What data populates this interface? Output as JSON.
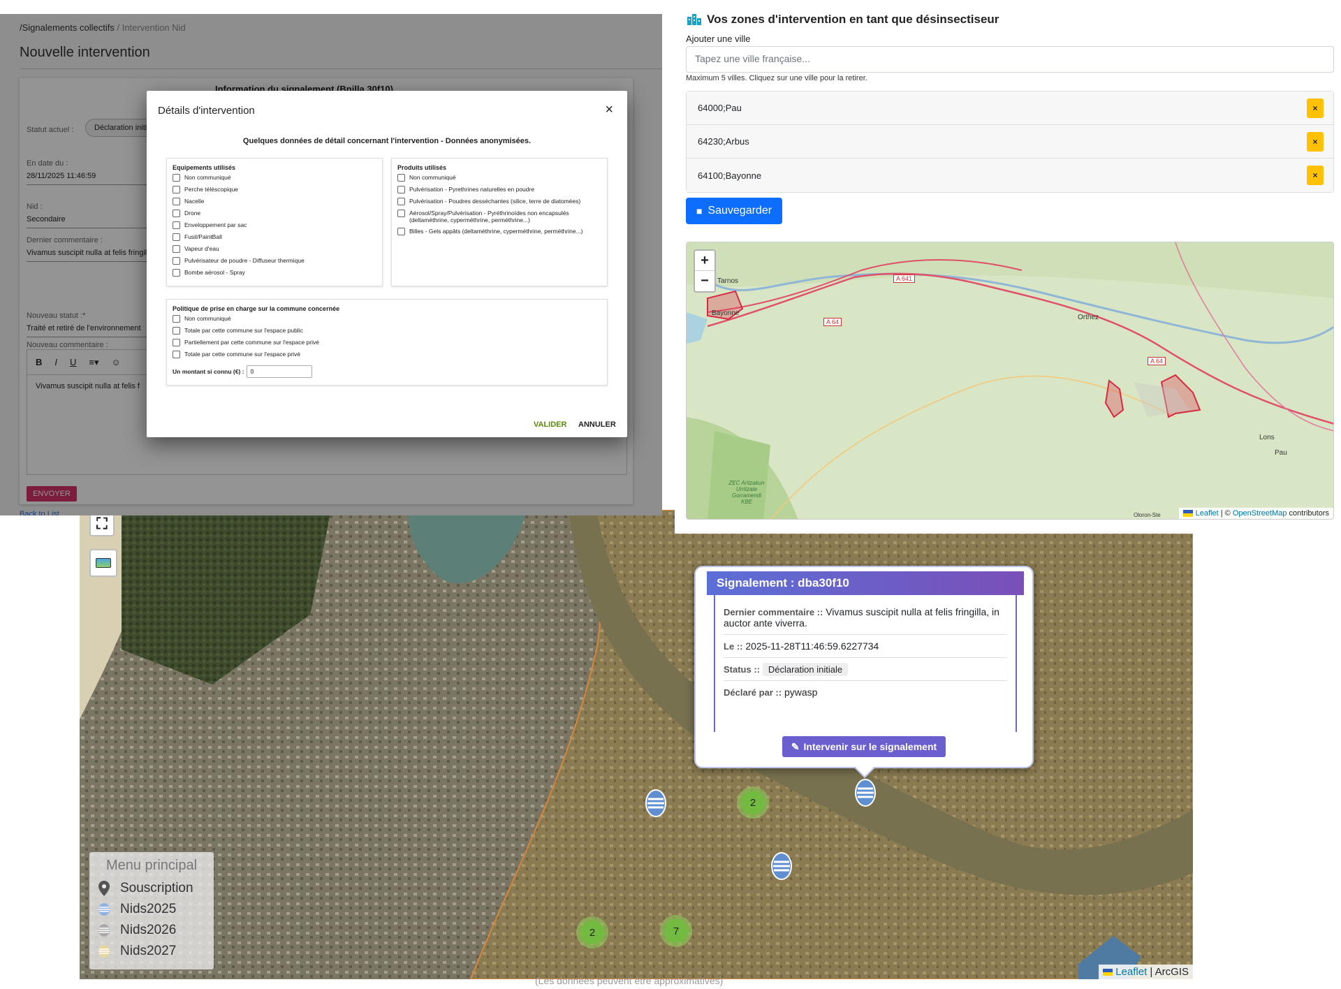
{
  "colors": {
    "primary": "#0d6efd",
    "warning": "#ffc107",
    "send": "#d6336c",
    "popup_header": "#6b5fd0",
    "validate": "#5a8a0a"
  },
  "left_app": {
    "breadcrumb_root": "/Signalements collectifs",
    "breadcrumb_sep": "/",
    "breadcrumb_current": "Intervention Nid",
    "page_title": "Nouvelle intervention",
    "card_heading_partial": "Information du signalement (Bnilla 30f10)",
    "status_label": "Statut actuel :",
    "status_value": "Déclaration initial",
    "date_label": "En date du :",
    "date_value": "28/11/2025 11:46:59",
    "nid_label": "Nid :",
    "nid_value": "Secondaire",
    "last_comment_label": "Dernier commentaire :",
    "last_comment_value": "Vivamus suscipit nulla at felis fringill",
    "new_status_label": "Nouveau statut :*",
    "new_status_value": "Traité et retiré de l'environnement",
    "new_comment_label": "Nouveau commentaire :",
    "editor_text": "Vivamus suscipit nulla at felis f",
    "editor_tools": [
      "B",
      "I",
      "U",
      "≡▾",
      "☺"
    ],
    "send_label": "ENVOYER",
    "back_link": "Back to List"
  },
  "modal": {
    "title": "Détails d'intervention",
    "close": "×",
    "subtitle": "Quelques données de détail concernant l'intervention - Données anonymisées.",
    "equipements": {
      "title": "Equipements utilisés",
      "options": [
        "Non communiqué",
        "Perche téléscopique",
        "Nacelle",
        "Drone",
        "Enveloppement par sac",
        "Fusil/PaintBall",
        "Vapeur d'eau",
        "Pulvérisateur de poudre - Diffuseur thermique",
        "Bombe aérosol - Spray"
      ]
    },
    "produits": {
      "title": "Produits utilisés",
      "options": [
        "Non communiqué",
        "Pulvérisation - Pyrethrines naturelles en poudre",
        "Pulvérisation - Poudres desséchantes (silice, terre de diatomées)",
        "Aérosol/Spray/Pulvérisation - Pyréthrinoïdes non encapsulés (deltaméthrine, cyperméthrine, perméthrine...)",
        "Billes - Gels appâts (deltaméthrine, cyperméthrine, perméthrine...)"
      ]
    },
    "politique": {
      "title": "Politique de prise en charge sur la commune concernée",
      "options": [
        "Non communiqué",
        "Totale par cette commune sur l'espace public",
        "Partiellement par cette commune sur l'espace privé",
        "Totale par cette commune sur l'espace privé"
      ],
      "amount_label": "Un montant si connu (€) :",
      "amount_value": "0"
    },
    "validate": "VALIDER",
    "cancel": "ANNULER"
  },
  "zones": {
    "title": "Vos zones d'intervention en tant que désinsectiseur",
    "add_label": "Ajouter une ville",
    "input_placeholder": "Tapez une ville française...",
    "help": "Maximum 5 villes. Cliquez sur une ville pour la retirer.",
    "cities": [
      "64000;Pau",
      "64230;Arbus",
      "64100;Bayonne"
    ],
    "remove_label": "×",
    "save_label": "Sauvegarder",
    "zoom_in": "+",
    "zoom_out": "−",
    "map_labels": [
      "Tarnos",
      "Bayonne",
      "A 641",
      "A 64",
      "Orthez",
      "A 64",
      "Lons",
      "Pau",
      "ZEC Aritzakun Urritzate Gorramendi KBE",
      "Oloron-Ste"
    ],
    "attribution": {
      "leaflet": "Leaflet",
      "sep": " | © ",
      "osm": "OpenStreetMap",
      "suffix": " contributors"
    }
  },
  "sat_map": {
    "legend_title": "Menu principal",
    "legend_items": [
      "Souscription",
      "Nids2025",
      "Nids2026",
      "Nids2027"
    ],
    "clusters": [
      "2",
      "2",
      "7"
    ],
    "attribution": {
      "leaflet": "Leaflet",
      "sep": " | ",
      "provider": "ArcGIS"
    },
    "hidden_text": "(Les données peuvent être approximatives)"
  },
  "popup": {
    "title": "Signalement : dba30f10",
    "close": "×",
    "comment_label": "Dernier commentaire ::",
    "comment_value": "Vivamus suscipit nulla at felis fringilla, in auctor ante viverra.",
    "date_label": "Le ::",
    "date_value": "2025-11-28T11:46:59.6227734",
    "status_label": "Status ::",
    "status_value": "Déclaration initiale",
    "declared_label": "Déclaré par ::",
    "declared_value": "pywasp",
    "action": "Intervenir sur le signalement"
  }
}
